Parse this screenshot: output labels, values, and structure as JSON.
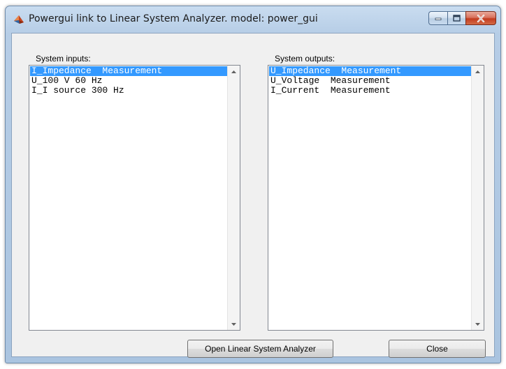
{
  "window": {
    "title": "Powergui link to Linear System Analyzer.  model: power_gui"
  },
  "icons": {
    "app": "matlab-app-icon",
    "minimize": "minimize-icon",
    "maximize": "maximize-icon",
    "close": "close-icon",
    "scroll_up": "scroll-up-arrow-icon",
    "scroll_down": "scroll-down-arrow-icon"
  },
  "inputs": {
    "label": "System inputs:",
    "items": [
      {
        "text": "I_Impedance  Measurement",
        "selected": true
      },
      {
        "text": "U_100 V 60 Hz",
        "selected": false
      },
      {
        "text": "I_I source 300 Hz",
        "selected": false
      }
    ]
  },
  "outputs": {
    "label": "System outputs:",
    "items": [
      {
        "text": "U_Impedance  Measurement",
        "selected": true
      },
      {
        "text": "U_Voltage  Measurement",
        "selected": false
      },
      {
        "text": "I_Current  Measurement",
        "selected": false
      }
    ]
  },
  "buttons": {
    "open_lsa": "Open Linear System Analyzer",
    "close": "Close"
  },
  "colors": {
    "selection": "#3399ff",
    "window_frame": "#b6cde6",
    "client_bg": "#f0f0f0",
    "close_button": "#c23c1f"
  }
}
